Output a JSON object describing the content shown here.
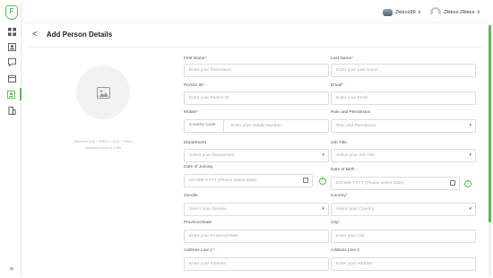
{
  "sidebar": {
    "logo": "F",
    "items": [
      "dashboard-icon",
      "id-card-icon",
      "message-icon",
      "calendar-icon",
      "person-card-icon",
      "building-icon"
    ],
    "collapse": "»"
  },
  "topbar": {
    "org_name": "Zkteco99",
    "user_name": "Zkteco Zkteco",
    "chevron": "∨"
  },
  "header": {
    "back": "<",
    "title": "Add Person Details"
  },
  "photo": {
    "hint_line1": "(Allowed only *.JPEG, *.JPG, *.PNG)",
    "hint_line2": "Maximum size of 2 MB"
  },
  "form": {
    "first_name": {
      "label": "First Name",
      "required": "*",
      "placeholder": "Enter your First Name"
    },
    "last_name": {
      "label": "Last Name",
      "required": "*",
      "placeholder": "Enter your Last Name"
    },
    "person_id": {
      "label": "Person ID",
      "required": "*",
      "placeholder": "Enter your Person ID"
    },
    "email": {
      "label": "Email",
      "required": "*",
      "placeholder": "Enter your Email"
    },
    "mobile": {
      "label": "Mobile",
      "required": "*",
      "country_code": "Country Code",
      "placeholder": "Enter your Mobile Number"
    },
    "role": {
      "label": "Role and Permission",
      "placeholder": "Role and Permission"
    },
    "department": {
      "label": "Department",
      "placeholder": "Select your Department"
    },
    "job_title": {
      "label": "Job Title",
      "placeholder": "Select your Job Title"
    },
    "date_joining": {
      "label": "Date of Joining",
      "placeholder": "DD-MM-YYYY (Please select Date)"
    },
    "date_birth": {
      "label": "Date of Birth",
      "placeholder": "DD-MM-YYYY (Please select Date)"
    },
    "gender": {
      "label": "Gender",
      "placeholder": "Select your Gender"
    },
    "country": {
      "label": "Country",
      "required": "*",
      "placeholder": "Select your Country"
    },
    "province": {
      "label": "Province/State",
      "placeholder": "Enter your Province/State"
    },
    "city": {
      "label": "City",
      "required": "*",
      "placeholder": "Enter your City"
    },
    "address1": {
      "label": "Address Line 1",
      "required": "*",
      "placeholder": "Enter your Address"
    },
    "address2": {
      "label": "Address Line 2",
      "placeholder": "Enter your Address"
    },
    "dropdown_arrow": "▾",
    "help_glyph": "?"
  },
  "colors": {
    "accent": "#5cb85c",
    "required": "#e74c3c"
  }
}
